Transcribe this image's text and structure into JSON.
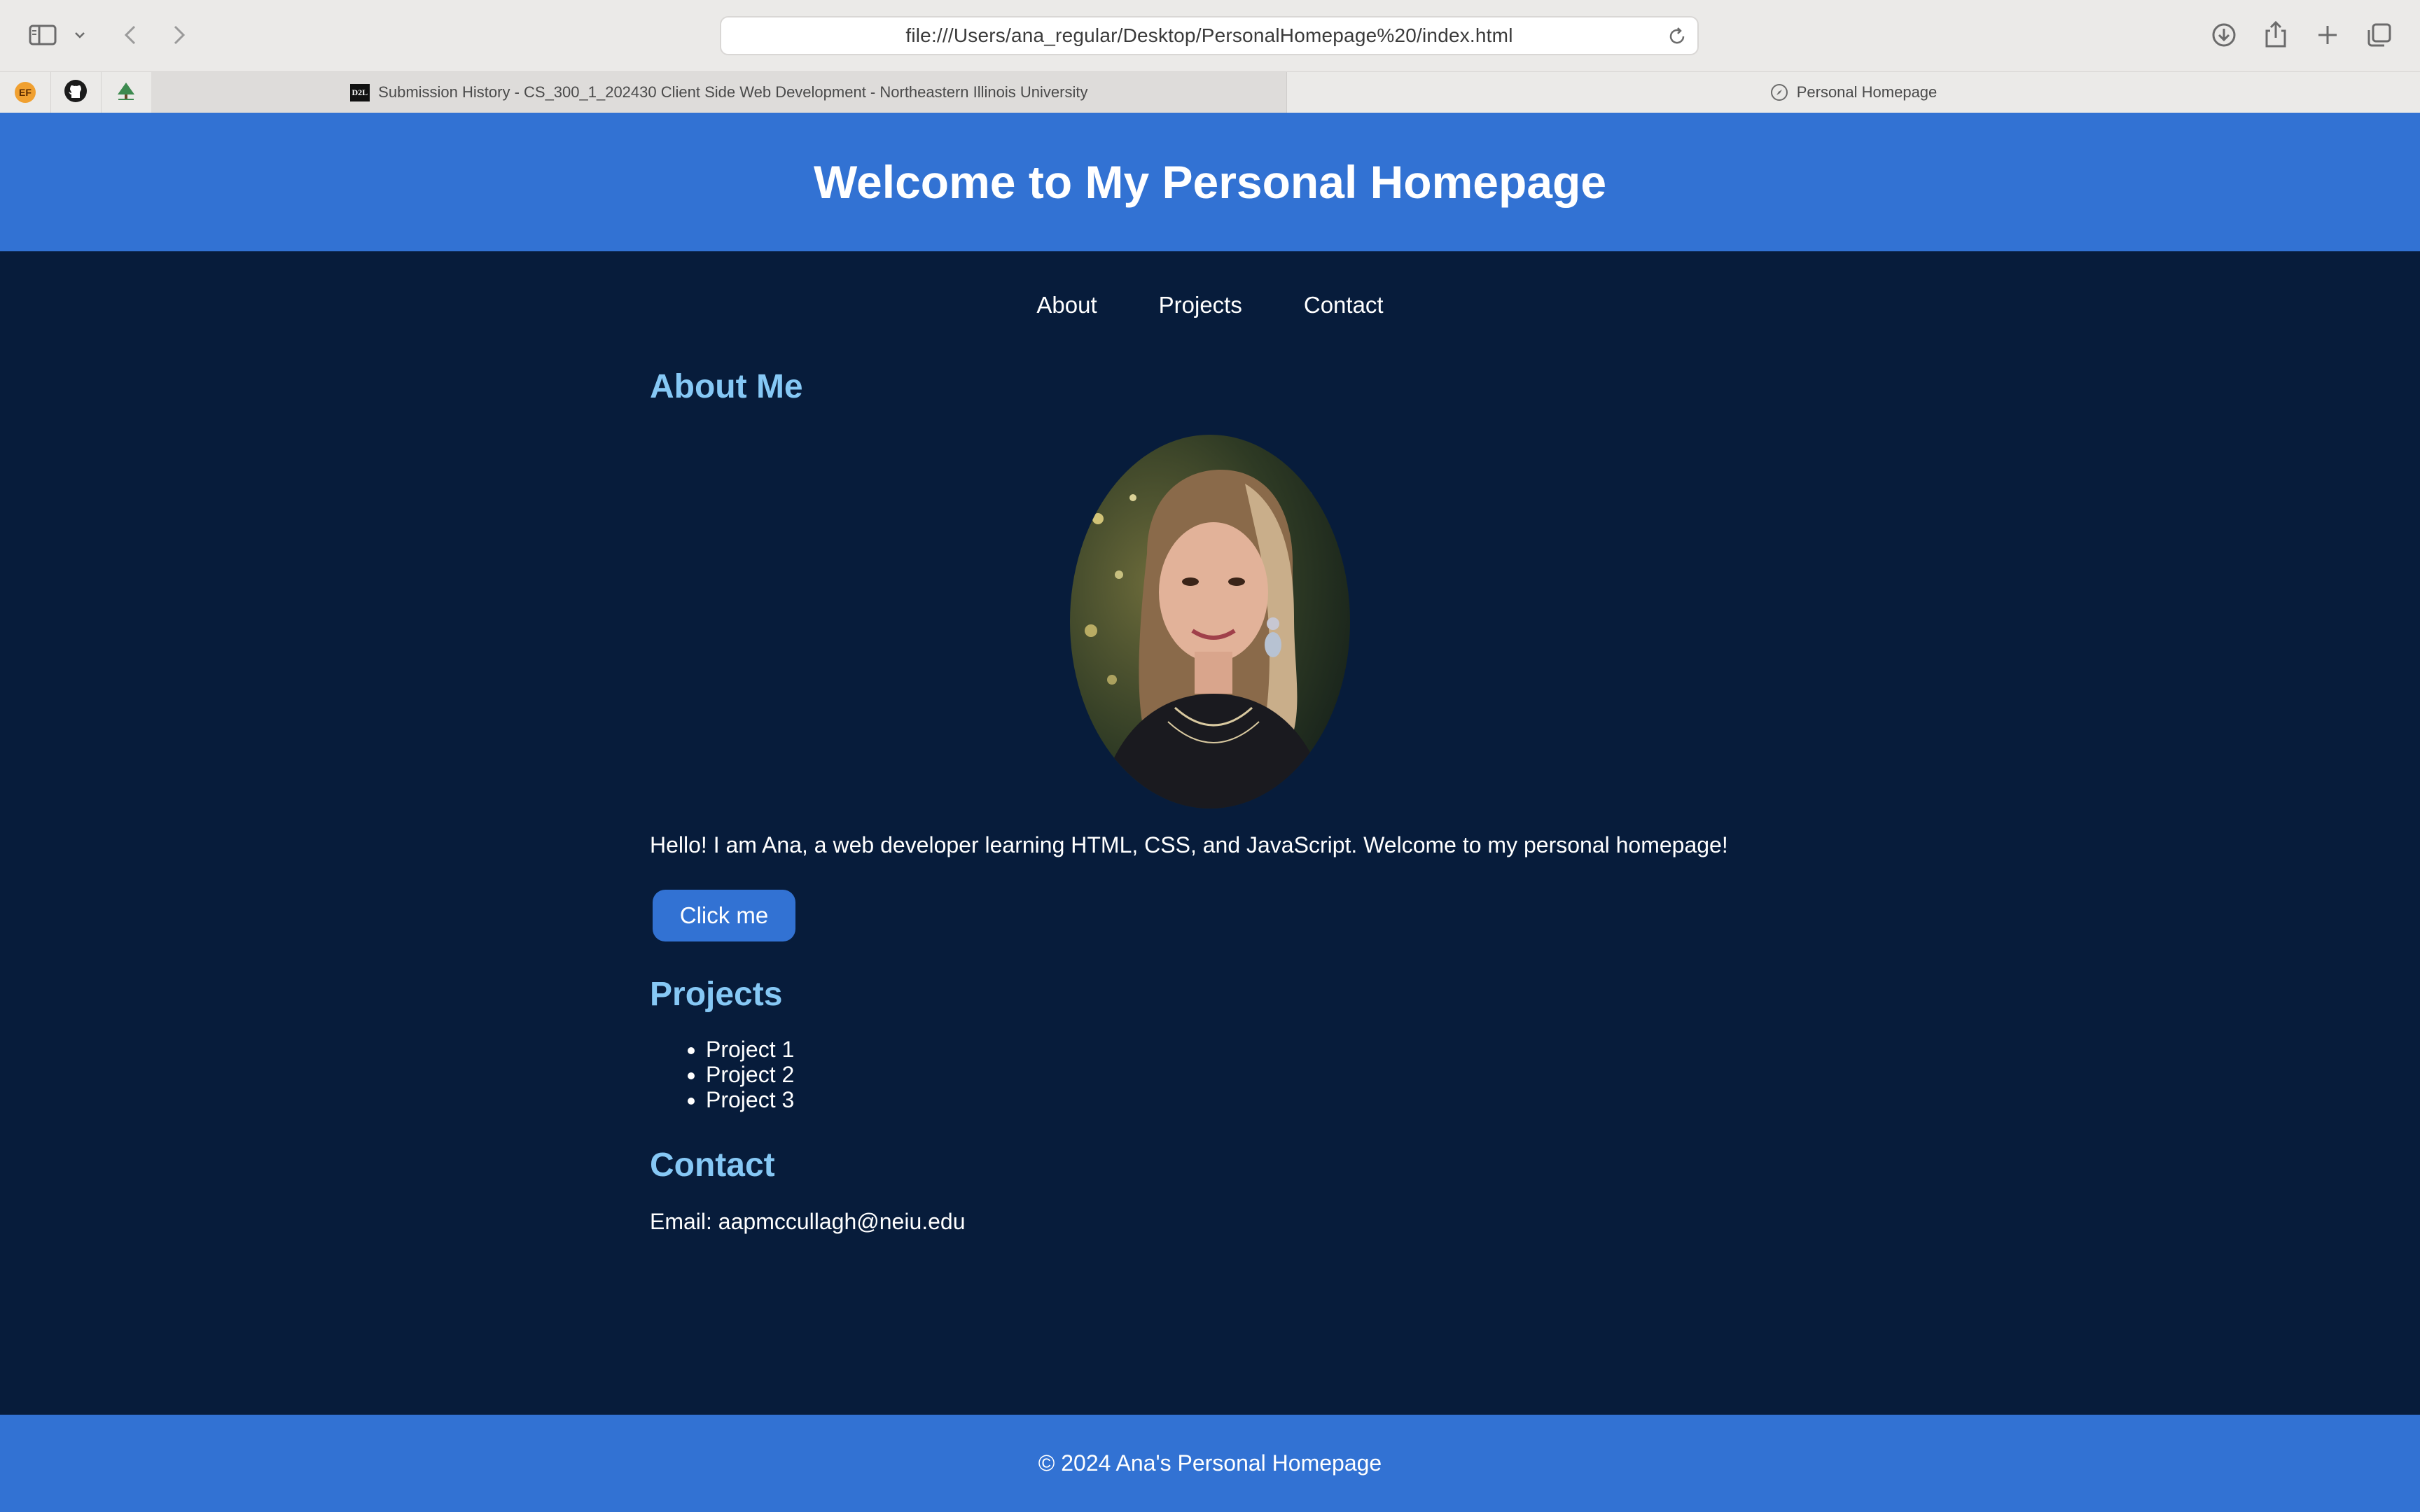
{
  "browser": {
    "url": "file:///Users/ana_regular/Desktop/PersonalHomepage%20/index.html",
    "pinned_tabs": [
      {
        "icon": "ef-icon",
        "label": "EF"
      },
      {
        "icon": "github-icon",
        "label": ""
      },
      {
        "icon": "tree-icon",
        "label": ""
      }
    ],
    "tabs": [
      {
        "title": "Submission History - CS_300_1_202430 Client Side Web Development - Northeastern Illinois University",
        "favicon": "D2L",
        "active": false
      },
      {
        "title": "Personal Homepage",
        "active": true
      }
    ],
    "colors": {
      "chrome": "#ebeae8",
      "url_bg": "#ffffff"
    }
  },
  "site": {
    "header_title": "Welcome to My Personal Homepage",
    "nav": [
      "About",
      "Projects",
      "Contact"
    ],
    "about": {
      "title": "About Me",
      "text": "Hello! I am Ana, a web developer learning HTML, CSS, and JavaScript. Welcome to my personal homepage!",
      "button_label": "Click me"
    },
    "projects": {
      "title": "Projects",
      "items": [
        "Project 1",
        "Project 2",
        "Project 3"
      ]
    },
    "contact": {
      "title": "Contact",
      "email_text": "Email: aapmccullagh@neiu.edu"
    },
    "footer": "© 2024 Ana's Personal Homepage",
    "colors": {
      "header_bg": "#3272d3",
      "page_bg": "#071c3b",
      "heading": "#86c8f5",
      "text": "#ffffff"
    }
  }
}
